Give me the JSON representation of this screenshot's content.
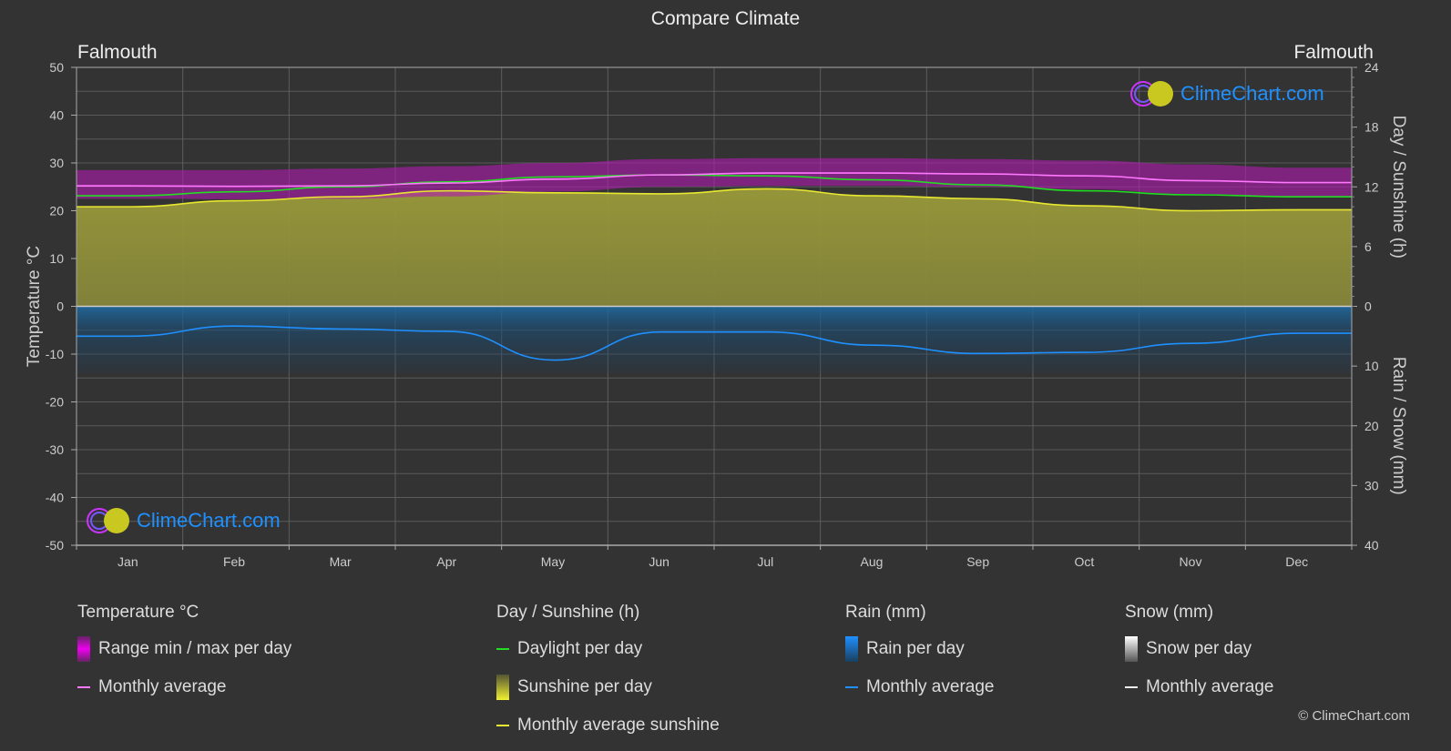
{
  "title": "Compare Climate",
  "location_left": "Falmouth",
  "location_right": "Falmouth",
  "watermark": "ClimeChart.com",
  "copyright": "© ClimeChart.com",
  "colors": {
    "background": "#333333",
    "temp_range": "#cc00cc",
    "temp_avg": "#ff77ff",
    "daylight": "#22dd22",
    "sunshine_fill": "#8a8a35",
    "sunshine_avg": "#e8e830",
    "rain_fill": "#1a5a8a",
    "rain_avg": "#1e90ff",
    "grid": "#666666",
    "brand": "#1e90ff"
  },
  "chart_data": {
    "type": "area",
    "title": "Compare Climate",
    "categories": [
      "Jan",
      "Feb",
      "Mar",
      "Apr",
      "May",
      "Jun",
      "Jul",
      "Aug",
      "Sep",
      "Oct",
      "Nov",
      "Dec"
    ],
    "y_left": {
      "label": "Temperature °C",
      "range": [
        -50,
        50
      ],
      "ticks": [
        50,
        40,
        30,
        20,
        10,
        0,
        -10,
        -20,
        -30,
        -40,
        -50
      ]
    },
    "y_right_top": {
      "label": "Day / Sunshine (h)",
      "range": [
        0,
        24
      ],
      "ticks": [
        24,
        18,
        12,
        6,
        0
      ]
    },
    "y_right_bottom": {
      "label": "Rain / Snow (mm)",
      "range": [
        0,
        40
      ],
      "ticks": [
        0,
        10,
        20,
        30,
        40
      ]
    },
    "grid": true,
    "series": [
      {
        "name": "Temperature monthly average",
        "axis": "temperature",
        "unit": "°C",
        "values": [
          25.2,
          25.1,
          25.2,
          25.8,
          26.6,
          27.5,
          27.9,
          27.9,
          27.7,
          27.3,
          26.3,
          25.9
        ]
      },
      {
        "name": "Temperature range max per day (approx.)",
        "axis": "temperature",
        "unit": "°C",
        "values": [
          28.5,
          28.5,
          28.8,
          29.3,
          30.0,
          30.8,
          31.0,
          31.0,
          30.8,
          30.5,
          29.7,
          29.0
        ]
      },
      {
        "name": "Temperature range min per day (approx.)",
        "axis": "temperature",
        "unit": "°C",
        "values": [
          22.5,
          22.4,
          22.5,
          23.0,
          24.0,
          25.0,
          25.2,
          25.2,
          25.0,
          24.5,
          23.5,
          23.0
        ]
      },
      {
        "name": "Daylight per day",
        "axis": "sunshine",
        "unit": "h",
        "values": [
          11.1,
          11.5,
          12.0,
          12.5,
          13.0,
          13.2,
          13.1,
          12.7,
          12.2,
          11.6,
          11.2,
          11.0
        ]
      },
      {
        "name": "Monthly average sunshine",
        "axis": "sunshine",
        "unit": "h",
        "values": [
          10.0,
          10.6,
          11.0,
          11.6,
          11.4,
          11.3,
          11.8,
          11.1,
          10.8,
          10.1,
          9.6,
          9.7
        ]
      },
      {
        "name": "Rain monthly average",
        "axis": "rain",
        "unit": "mm",
        "values": [
          5.0,
          3.3,
          3.8,
          4.2,
          9.0,
          4.3,
          4.3,
          6.5,
          7.9,
          7.7,
          6.2,
          4.5
        ]
      }
    ],
    "legend": {
      "placement": "bottom",
      "groups": [
        {
          "title": "Temperature °C",
          "items": [
            {
              "label": "Range min / max per day",
              "kind": "bar",
              "color": "#ee00ee"
            },
            {
              "label": "Monthly average",
              "kind": "line",
              "color": "#ff77ff"
            }
          ]
        },
        {
          "title": "Day / Sunshine (h)",
          "items": [
            {
              "label": "Daylight per day",
              "kind": "line",
              "color": "#22dd22"
            },
            {
              "label": "Sunshine per day",
              "kind": "bar",
              "color": "#e8e830"
            },
            {
              "label": "Monthly average sunshine",
              "kind": "line",
              "color": "#e8e830"
            }
          ]
        },
        {
          "title": "Rain (mm)",
          "items": [
            {
              "label": "Rain per day",
              "kind": "bar",
              "color": "#1e90ff"
            },
            {
              "label": "Monthly average",
              "kind": "line",
              "color": "#1e90ff"
            }
          ]
        },
        {
          "title": "Snow (mm)",
          "items": [
            {
              "label": "Snow per day",
              "kind": "bar",
              "color": "#eeeeee"
            },
            {
              "label": "Monthly average",
              "kind": "line",
              "color": "#eeeeee"
            }
          ]
        }
      ]
    }
  }
}
